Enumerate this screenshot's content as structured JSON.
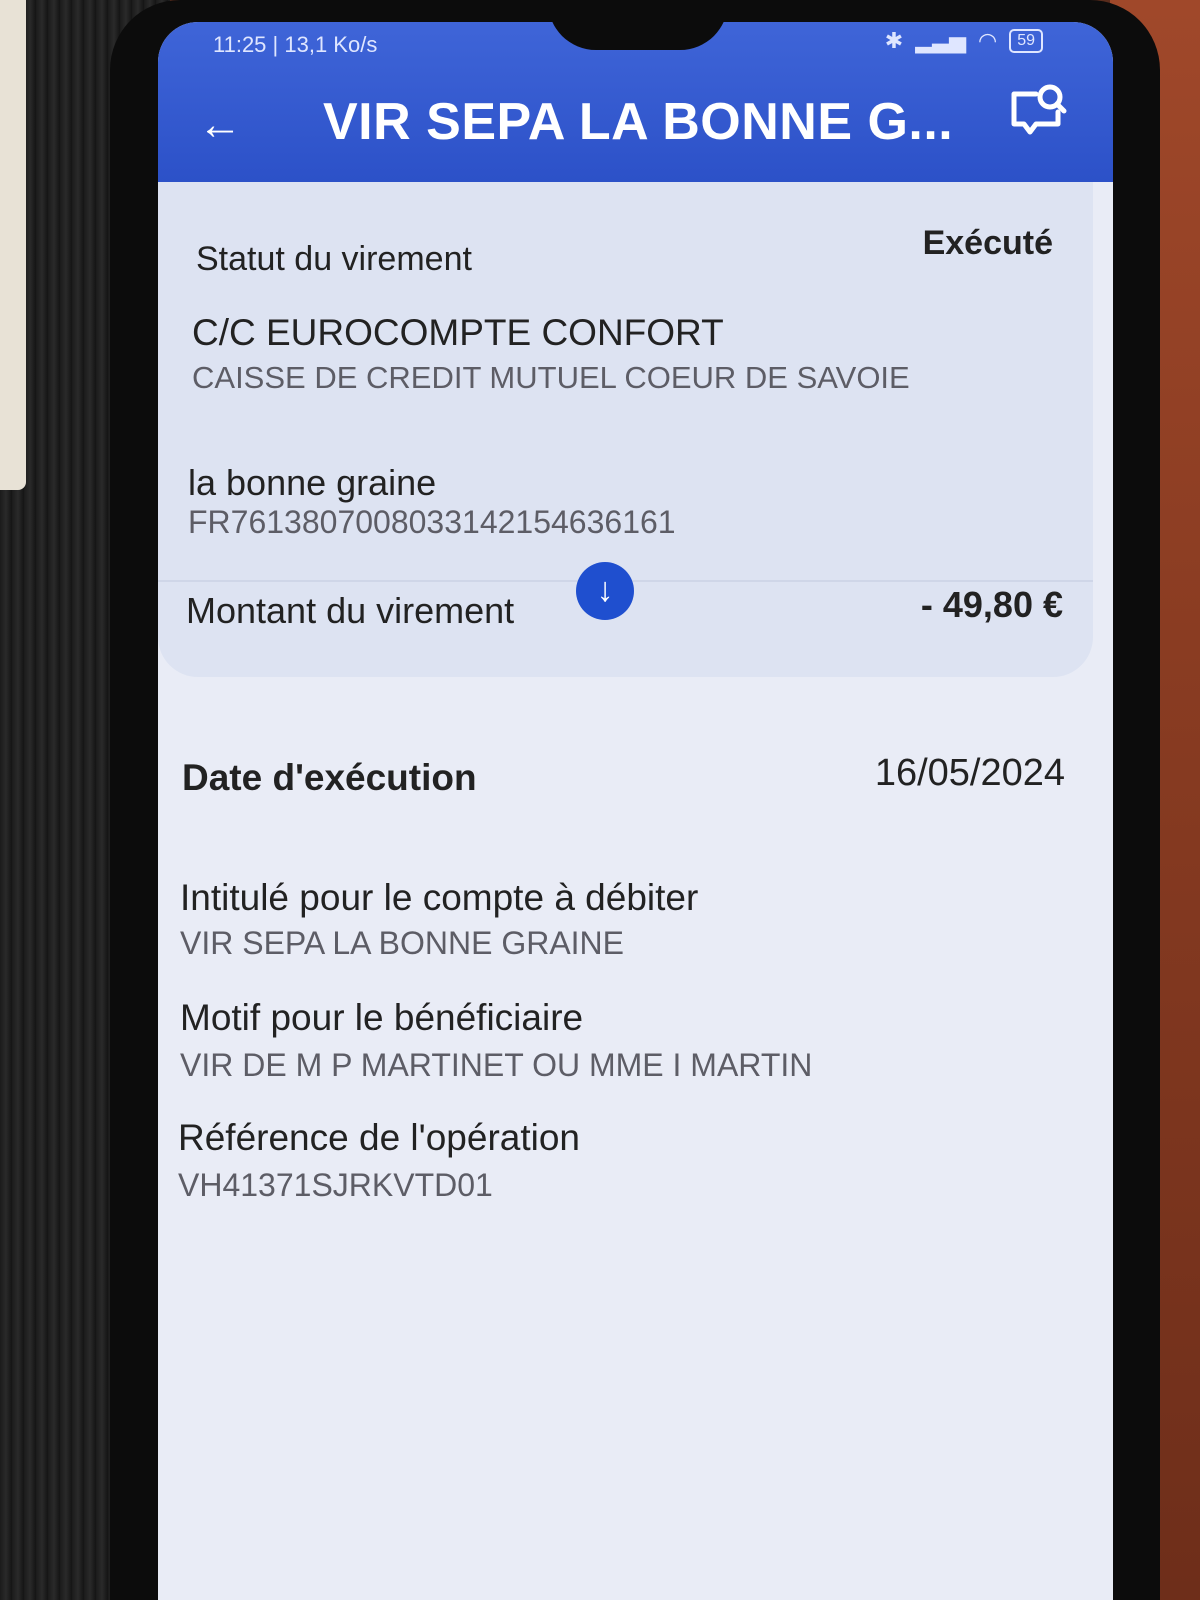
{
  "status_bar": {
    "time_speed": "11:25 | 13,1 Ko/s",
    "battery": "59"
  },
  "header": {
    "title": "VIR SEPA LA BONNE G..."
  },
  "icons": {
    "back": "arrow-left-icon",
    "chat": "chat-search-icon",
    "down": "arrow-down-icon"
  },
  "colors": {
    "header_blue": "#2c51c8",
    "accent_button": "#1f4fcf"
  },
  "summary": {
    "status_label": "Statut du virement",
    "status_value": "Exécuté",
    "account_name": "C/C EUROCOMPTE CONFORT",
    "bank_name": "CAISSE DE CREDIT MUTUEL COEUR DE SAVOIE",
    "beneficiary_name": "la bonne graine",
    "beneficiary_iban": "FR7613807008033142154636161",
    "amount_label": "Montant du virement",
    "amount_value": "- 49,80 €"
  },
  "details": {
    "date_label": "Date d'exécution",
    "date_value": "16/05/2024",
    "debit_label": "Intitulé pour le compte à débiter",
    "debit_value": "VIR SEPA LA BONNE GRAINE",
    "motif_label": "Motif pour le bénéficiaire",
    "motif_value": "VIR DE M P MARTINET OU MME I MARTIN",
    "reference_label": "Référence de l'opération",
    "reference_value": "VH41371SJRKVTD01"
  }
}
